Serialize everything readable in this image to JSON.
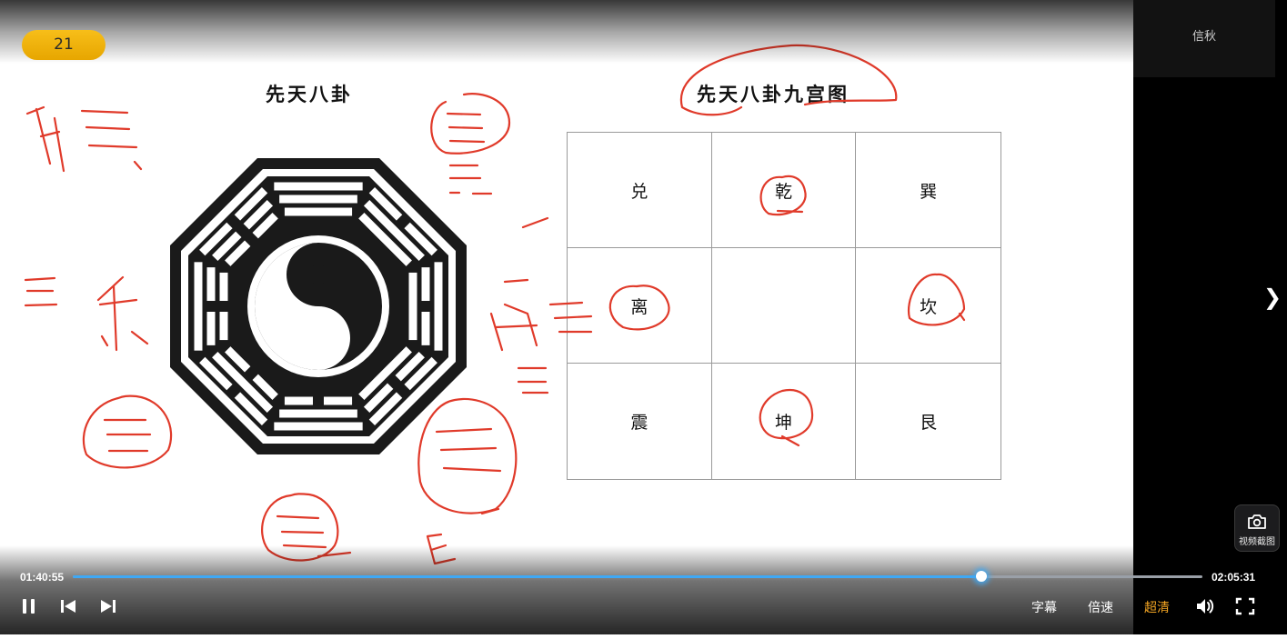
{
  "video": {
    "chapter_number": "21",
    "slide": {
      "left_title": "先天八卦",
      "right_title": "先天八卦九宫图",
      "grid_cells": [
        "兑",
        "乾",
        "巽",
        "离",
        "",
        "坎",
        "震",
        "坤",
        "艮"
      ]
    }
  },
  "player": {
    "current_time": "01:40:55",
    "total_time": "02:05:31",
    "progress": 0.8044,
    "subtitle_label": "字幕",
    "speed_label": "倍速",
    "quality_label": "超清",
    "quality_color": "#f5a623",
    "progress_color": "#3fa8f5"
  },
  "side_panel": {
    "tab_label": "信秋",
    "screenshot_label": "视频截图",
    "screenshot_icon": "camera-icon",
    "next_icon": "chevron-right-icon"
  }
}
